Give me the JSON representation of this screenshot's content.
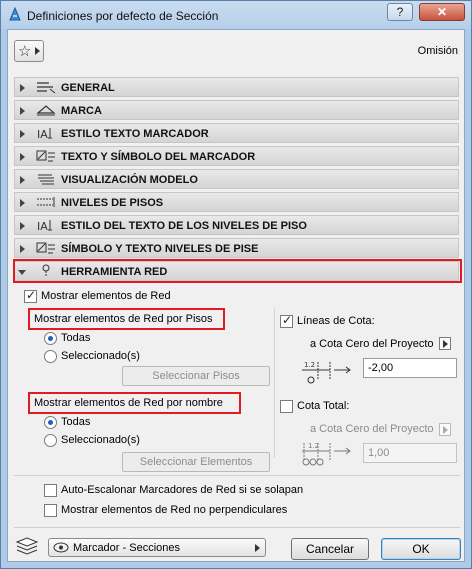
{
  "window": {
    "title": "Definiciones por defecto de Sección",
    "help_label": "?",
    "close_label": "✕"
  },
  "header": {
    "omision_label": "Omisión"
  },
  "sections": [
    {
      "label": "GENERAL",
      "icon": "general-settings-icon",
      "open": false
    },
    {
      "label": "MARCA",
      "icon": "marker-icon",
      "open": false
    },
    {
      "label": "ESTILO TEXTO MARCADOR",
      "icon": "text-style-icon",
      "open": false
    },
    {
      "label": "TEXTO Y SÍMBOLO DEL MARCADOR",
      "icon": "symbol-text-icon",
      "open": false
    },
    {
      "label": "VISUALIZACIÓN MODELO",
      "icon": "model-display-icon",
      "open": false
    },
    {
      "label": "NIVELES DE PISOS",
      "icon": "story-levels-icon",
      "open": false
    },
    {
      "label": "ESTILO DEL TEXTO DE LOS NIVELES DE PISO",
      "icon": "level-text-style-icon",
      "open": false
    },
    {
      "label": "SÍMBOLO Y TEXTO NIVELES DE PISE",
      "icon": "level-symbol-text-icon",
      "open": false
    },
    {
      "label": "HERRAMIENTA RED",
      "icon": "grid-tool-icon",
      "open": true
    }
  ],
  "grid": {
    "show_grid_label": "Mostrar elementos de Red",
    "show_grid_checked": true,
    "by_stories": {
      "title": "Mostrar elementos de Red por Pisos",
      "option_all": "Todas",
      "option_selected": "Seleccionado(s)",
      "selected_option": "Todas",
      "select_button": "Seleccionar Pisos"
    },
    "by_name": {
      "title": "Mostrar elementos de Red por nombre",
      "option_all": "Todas",
      "option_selected": "Seleccionado(s)",
      "selected_option": "Todas",
      "select_button": "Seleccionar Elementos"
    },
    "dimension_lines": {
      "label": "Líneas de Cota:",
      "checked": true,
      "reference_label": "a Cota Cero del Proyecto",
      "value": "-2,00",
      "diagram_label": "1.2"
    },
    "total_dimension": {
      "label": "Cota Total:",
      "checked": false,
      "reference_label": "a Cota Cero del Proyecto",
      "value": "1,00",
      "diagram_label": "1.2"
    },
    "auto_stagger_label": "Auto-Escalonar Marcadores de Red si se solapan",
    "auto_stagger_checked": false,
    "non_perpendicular_label": "Mostrar elementos de Red no perpendiculares",
    "non_perpendicular_checked": false
  },
  "footer": {
    "layer_select_value": "Marcador - Secciones",
    "cancel_label": "Cancelar",
    "ok_label": "OK"
  },
  "colors": {
    "highlight_box": "#e11b22",
    "accent": "#1f5fbf",
    "titlebar": "#b5cfea"
  }
}
